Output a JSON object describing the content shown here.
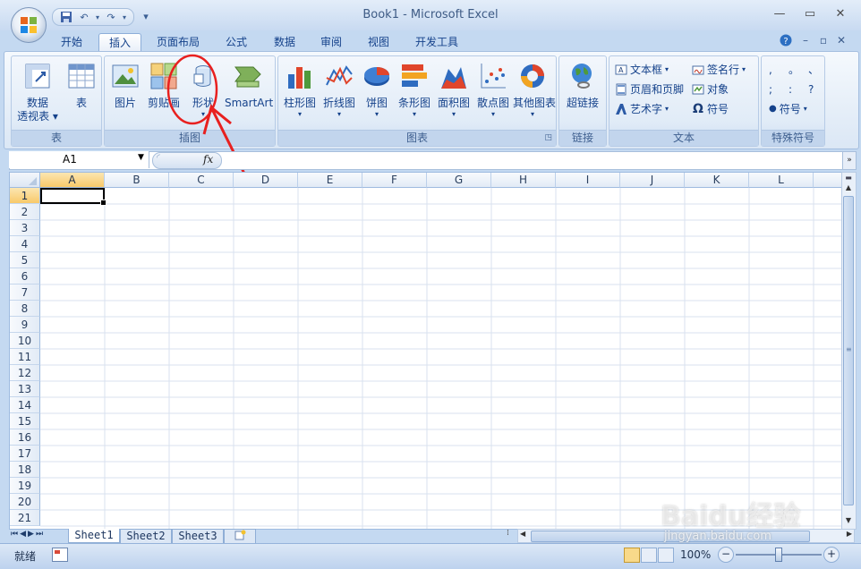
{
  "window": {
    "title": "Book1 - Microsoft Excel",
    "controls": [
      "minimize",
      "maximize",
      "close"
    ]
  },
  "quick_access": {
    "icons": [
      "save-icon",
      "undo-icon",
      "redo-icon",
      "customize-icon"
    ],
    "undo_glyph": "↶",
    "redo_glyph": "↷",
    "dropdown_glyph": "▾"
  },
  "tabs": [
    {
      "label": "开始",
      "active": false
    },
    {
      "label": "插入",
      "active": true
    },
    {
      "label": "页面布局",
      "active": false
    },
    {
      "label": "公式",
      "active": false
    },
    {
      "label": "数据",
      "active": false
    },
    {
      "label": "审阅",
      "active": false
    },
    {
      "label": "视图",
      "active": false
    },
    {
      "label": "开发工具",
      "active": false
    }
  ],
  "ribbon": {
    "groups": {
      "tables": {
        "label": "表",
        "pivot_line1": "数据",
        "pivot_line2": "透视表",
        "table": "表"
      },
      "illustrations": {
        "label": "插图",
        "picture": "图片",
        "clipart": "剪贴画",
        "shapes": "形状",
        "smartart": "SmartArt"
      },
      "charts": {
        "label": "图表",
        "items": [
          "柱形图",
          "折线图",
          "饼图",
          "条形图",
          "面积图",
          "散点图",
          "其他图表"
        ]
      },
      "links": {
        "label": "链接",
        "hyperlink": "超链接"
      },
      "text": {
        "label": "文本",
        "textbox": "文本框",
        "header_footer": "页眉和页脚",
        "wordart": "艺术字",
        "signature": "签名行",
        "object": "对象",
        "symbol": "符号"
      },
      "special": {
        "label": "特殊符号",
        "chars": [
          ",",
          "。",
          "、",
          ";",
          ":",
          "?"
        ],
        "symbol_btn": "符号"
      }
    },
    "colors": {
      "highlight": "#e8201f",
      "ribbon_text": "#15428b"
    }
  },
  "formula_bar": {
    "name_box": "A1",
    "fx_label": "fx",
    "formula": ""
  },
  "grid": {
    "columns": [
      "A",
      "B",
      "C",
      "D",
      "E",
      "F",
      "G",
      "H",
      "I",
      "J",
      "K",
      "L"
    ],
    "rows": [
      "1",
      "2",
      "3",
      "4",
      "5",
      "6",
      "7",
      "8",
      "9",
      "10",
      "11",
      "12",
      "13",
      "14",
      "15",
      "16",
      "17",
      "18",
      "19",
      "20",
      "21"
    ],
    "active_cell": "A1"
  },
  "sheets": {
    "tabs": [
      "Sheet1",
      "Sheet2",
      "Sheet3"
    ],
    "active": "Sheet1"
  },
  "status": {
    "ready": "就绪",
    "zoom": "100%",
    "zoom_minus": "−",
    "zoom_plus": "+"
  },
  "watermark": {
    "brand": "Baidu经验",
    "url": "jingyan.baidu.com"
  }
}
